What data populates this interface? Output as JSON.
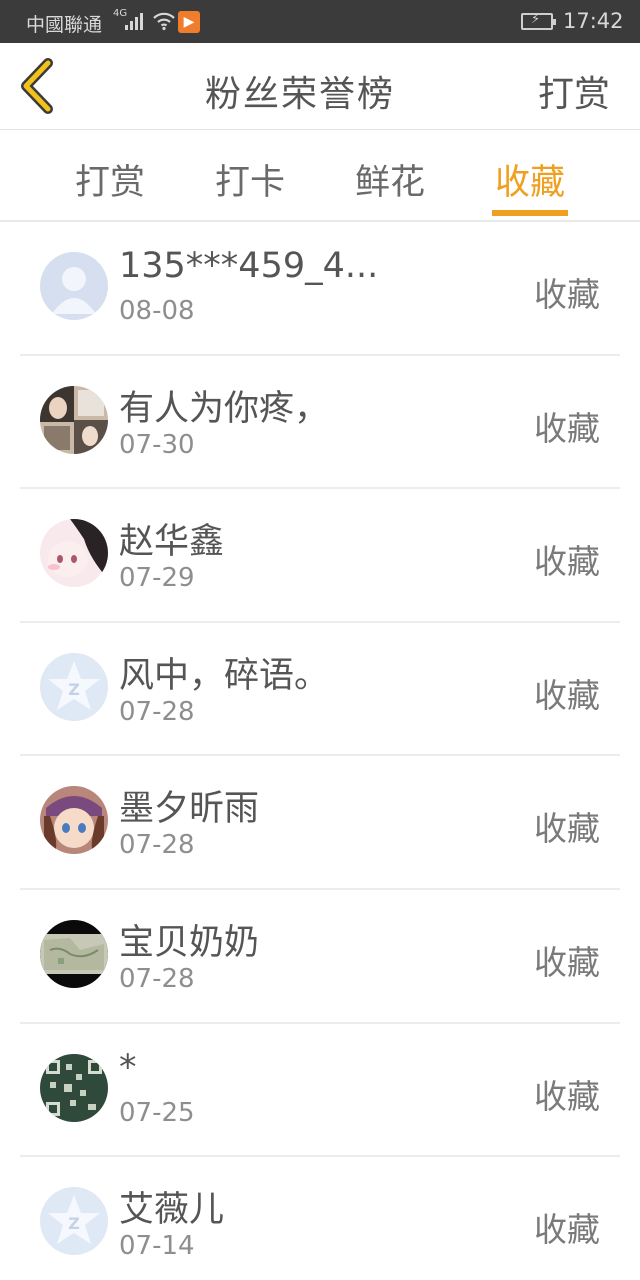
{
  "status_bar": {
    "carrier": "中國聯通",
    "network": "4G",
    "time": "17:42"
  },
  "nav": {
    "title": "粉丝荣誉榜",
    "right_action": "打赏"
  },
  "tabs": [
    {
      "label": "打赏",
      "active": false
    },
    {
      "label": "打卡",
      "active": false
    },
    {
      "label": "鲜花",
      "active": false
    },
    {
      "label": "收藏",
      "active": true
    }
  ],
  "colors": {
    "accent": "#f0a020",
    "status_bar": "#3b3b3b"
  },
  "fans": [
    {
      "name": "135***459_4...",
      "date": "08-08",
      "action": "收藏",
      "avatar": "default-person"
    },
    {
      "name": "有人为你疼，",
      "date": "07-30",
      "action": "收藏",
      "avatar": "photo-collage"
    },
    {
      "name": "赵华鑫",
      "date": "07-29",
      "action": "收藏",
      "avatar": "anime-girl-pink"
    },
    {
      "name": "风中，碎语。",
      "date": "07-28",
      "action": "收藏",
      "avatar": "qq-default-star"
    },
    {
      "name": "墨夕昕雨",
      "date": "07-28",
      "action": "收藏",
      "avatar": "anime-girl-hat"
    },
    {
      "name": "宝贝奶奶",
      "date": "07-28",
      "action": "收藏",
      "avatar": "photo-map"
    },
    {
      "name": "*",
      "date": "07-25",
      "action": "收藏",
      "avatar": "qr-pattern"
    },
    {
      "name": "艾薇儿",
      "date": "07-14",
      "action": "收藏",
      "avatar": "qq-default-star"
    }
  ]
}
